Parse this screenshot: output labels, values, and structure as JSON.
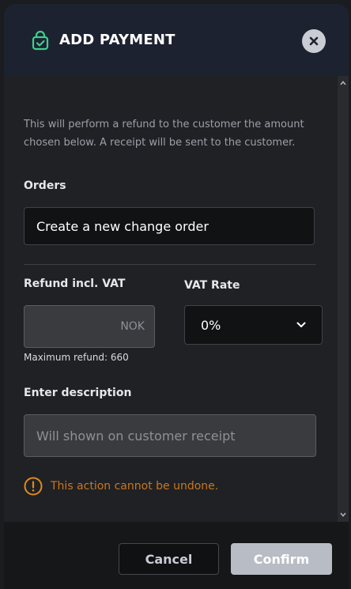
{
  "header": {
    "title": "ADD PAYMENT",
    "icon": "shopping-bag-check-icon",
    "close_icon": "close-icon"
  },
  "intro": "This will perform a refund to the customer the amount chosen below. A receipt will be sent to the customer.",
  "orders": {
    "label": "Orders",
    "value": "Create a new change order"
  },
  "refund": {
    "label": "Refund incl. VAT",
    "value": "",
    "suffix": "NOK",
    "max_text": "Maximum refund: 660"
  },
  "vat": {
    "label": "VAT Rate",
    "selected": "0%"
  },
  "description": {
    "label": "Enter description",
    "placeholder": "Will shown on customer receipt"
  },
  "warning": "This action cannot be undone.",
  "footer": {
    "cancel": "Cancel",
    "confirm": "Confirm"
  },
  "colors": {
    "accent_green": "#3ecf8e",
    "warning_orange": "#e08a1e",
    "header_bg": "#1d2230"
  }
}
